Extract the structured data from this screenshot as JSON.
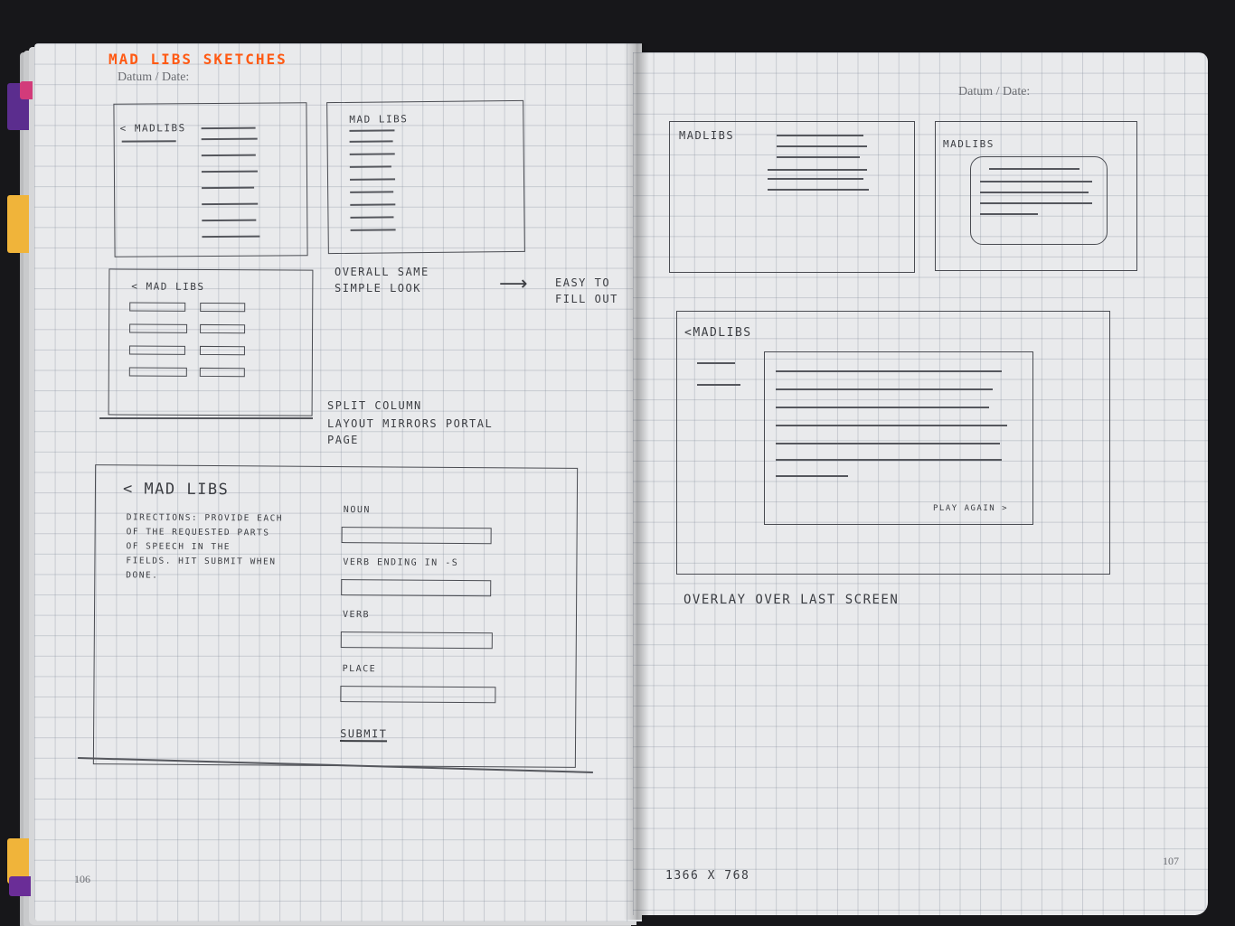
{
  "notebook": {
    "title": "MAD LIBS SKETCHES",
    "date_label_left": "Datum / Date:",
    "date_label_right": "Datum / Date:",
    "page_number_left": "106",
    "page_number_right": "107"
  },
  "sketch1": {
    "label": "< MADLIBS"
  },
  "sketch2": {
    "label": "MAD LIBS"
  },
  "sketch3": {
    "label": "< MAD LIBS"
  },
  "notes": {
    "overall_line1": "OVERALL SAME",
    "overall_line2": "SIMPLE LOOK",
    "arrow": "⟶",
    "easy_line1": "EASY TO",
    "easy_line2": "FILL OUT",
    "split_line1": "SPLIT COLUMN",
    "split_line2": "LAYOUT MIRRORS PORTAL",
    "split_line3": "PAGE"
  },
  "form_sketch": {
    "title": "< MAD LIBS",
    "directions": [
      "DIRECTIONS: PROVIDE EACH",
      "OF THE REQUESTED PARTS",
      "OF SPEECH IN THE",
      "FIELDS. HIT SUBMIT WHEN",
      "DONE."
    ],
    "fields": [
      {
        "label": "NOUN"
      },
      {
        "label": "VERB ENDING IN -S"
      },
      {
        "label": "VERB"
      },
      {
        "label": "PLACE"
      }
    ],
    "submit": "SUBMIT"
  },
  "right_sketch1": {
    "label": "MADLIBS"
  },
  "right_sketch2": {
    "label": "MADLIBS"
  },
  "overlay_sketch": {
    "title": "<MADLIBS",
    "play_again": "PLAY AGAIN >"
  },
  "overlay_note": "OVERLAY OVER LAST SCREEN",
  "resolution_note": "1366 x 768"
}
